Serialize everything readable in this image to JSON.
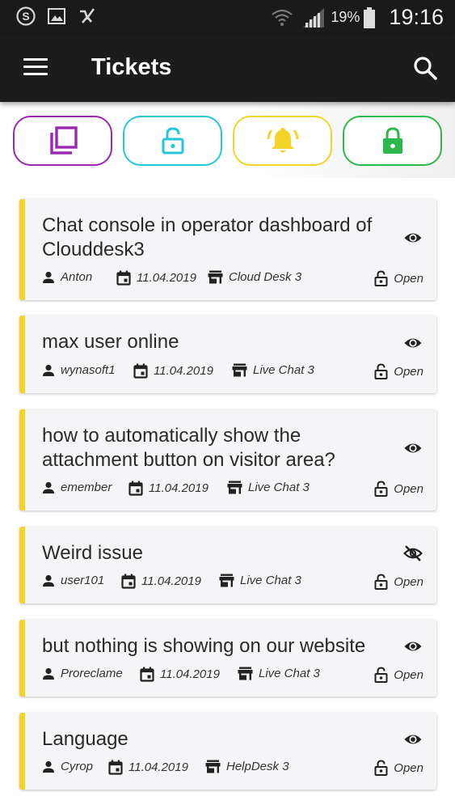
{
  "status_bar": {
    "battery_pct": "19%",
    "time": "19:16"
  },
  "app_bar": {
    "title": "Tickets"
  },
  "filters": [
    {
      "name": "all",
      "icon": "copy-icon",
      "color": "#9c27b0"
    },
    {
      "name": "unassigned",
      "icon": "lock-open-icon",
      "color": "#26c6da"
    },
    {
      "name": "notifications",
      "icon": "bell-icon",
      "color": "#f5d42a"
    },
    {
      "name": "closed",
      "icon": "lock-icon",
      "color": "#2db84d"
    }
  ],
  "tickets": [
    {
      "title": "Chat console in operator dashboard of Clouddesk3",
      "user": "Anton",
      "date": "11.04.2019",
      "desk": "Cloud Desk 3",
      "status": "Open",
      "seen": true
    },
    {
      "title": "max user online",
      "user": "wynasoft1",
      "date": "11.04.2019",
      "desk": "Live Chat 3",
      "status": "Open",
      "seen": true
    },
    {
      "title": "how to automatically show the attachment button on visitor area?",
      "user": "emember",
      "date": "11.04.2019",
      "desk": "Live Chat 3",
      "status": "Open",
      "seen": true
    },
    {
      "title": "Weird issue",
      "user": "user101",
      "date": "11.04.2019",
      "desk": "Live Chat 3",
      "status": "Open",
      "seen": false
    },
    {
      "title": "but nothing is showing on our website",
      "user": "Proreclame",
      "date": "11.04.2019",
      "desk": "Live Chat 3",
      "status": "Open",
      "seen": true
    },
    {
      "title": "Language",
      "user": "Cyrop",
      "date": "11.04.2019",
      "desk": "HelpDesk 3",
      "status": "Open",
      "seen": true
    }
  ]
}
